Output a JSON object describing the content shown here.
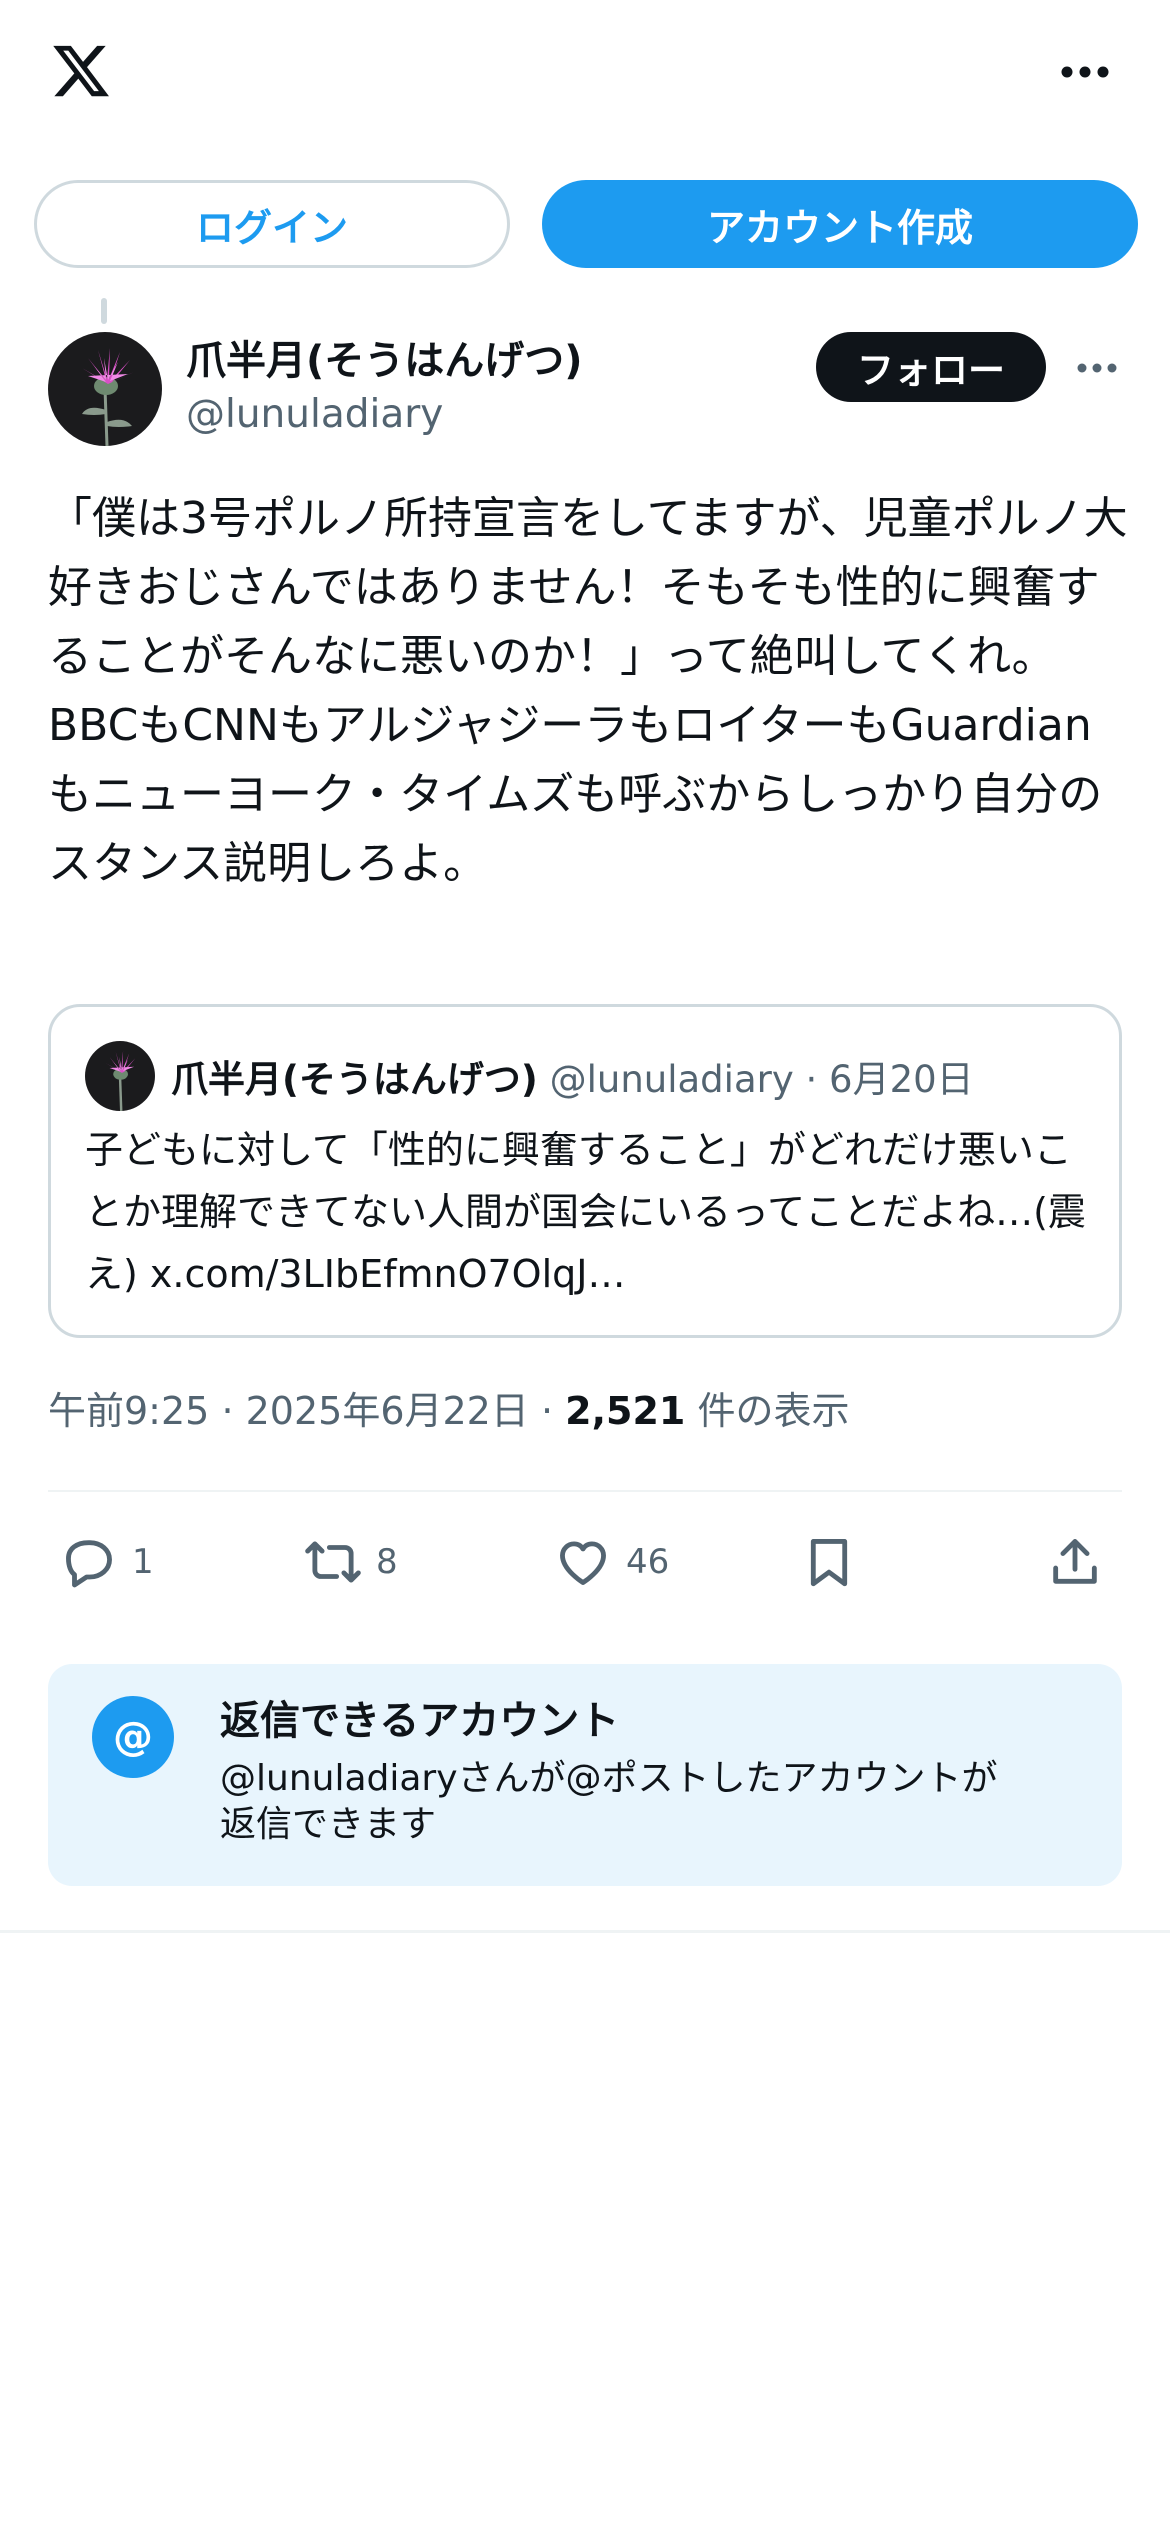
{
  "header": {
    "logo_icon": "x-logo-icon",
    "more_icon": "more-horizontal-icon"
  },
  "auth": {
    "login_label": "ログイン",
    "signup_label": "アカウント作成"
  },
  "post": {
    "author_name": "爪半月(そうはんげつ)",
    "author_handle": "@lunuladiary",
    "follow_label": "フォロー",
    "text": "「僕は3号ポルノ所持宣言をしてますが、児童ポルノ大好きおじさんではありません！そもそも性的に興奮することがそんなに悪いのか！」って絶叫してくれ。\nBBCもCNNもアルジャジーラもロイターもGuardianもニューヨーク・タイムズも呼ぶからしっかり自分のスタンス説明しろよ。",
    "time": "午前9:25",
    "date": "2025年6月22日",
    "separator": "·",
    "views_count": "2,521",
    "views_label": "件の表示"
  },
  "quote": {
    "author_name": "爪半月(そうはんげつ)",
    "author_handle": "@lunuladiary",
    "separator": "·",
    "date": "6月20日",
    "text": "子どもに対して「性的に興奮すること」がどれだけ悪いことか理解できてない人間が国会にいるってことだよね…(震え) x.com/3LIbEfmnO7OlqJ…"
  },
  "actions": {
    "reply_count": "1",
    "repost_count": "8",
    "like_count": "46",
    "icons": [
      "reply-icon",
      "repost-icon",
      "like-icon",
      "bookmark-icon",
      "share-icon"
    ]
  },
  "reply_restriction": {
    "icon_glyph": "@",
    "title": "返信できるアカウント",
    "description": "@lunuladiaryさんが@ポストしたアカウントが\n返信できます"
  },
  "colors": {
    "accent": "#1d9bf0",
    "text_primary": "#0f1419",
    "text_secondary": "#536471",
    "border": "#cfd9de",
    "reply_box_bg": "#e8f5fd"
  }
}
